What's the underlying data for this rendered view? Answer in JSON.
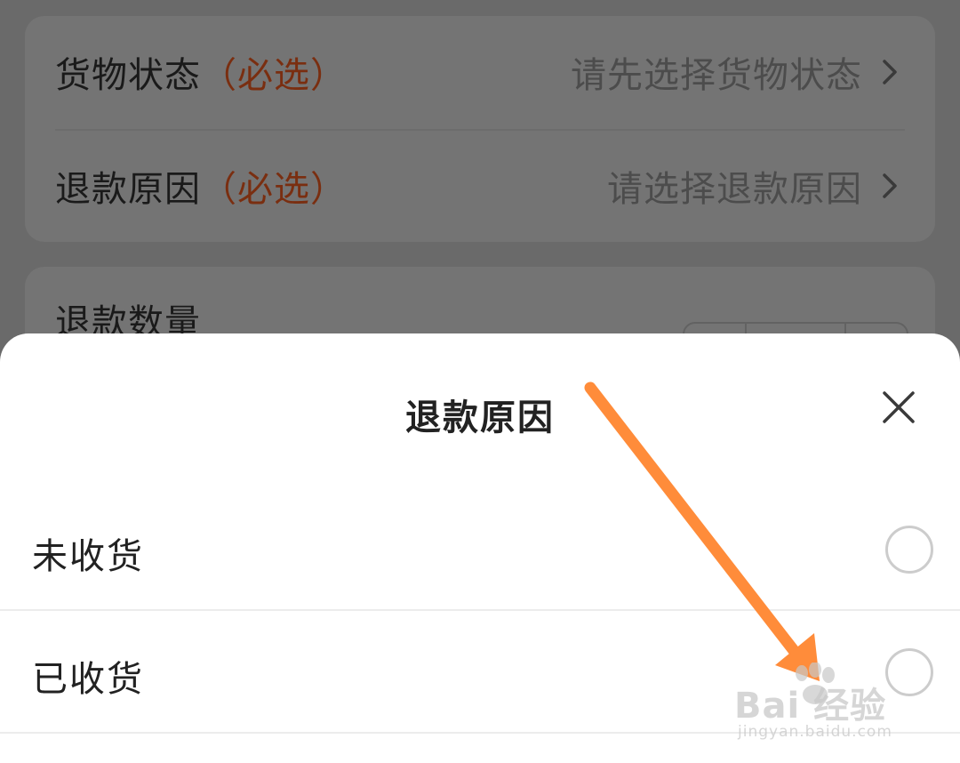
{
  "background_page": {
    "rows": [
      {
        "label": "货物状态",
        "required": "（必选）",
        "value": "请先选择货物状态"
      },
      {
        "label": "退款原因",
        "required": "（必选）",
        "value": "请选择退款原因"
      }
    ],
    "quantity_label": "退款数量"
  },
  "sheet": {
    "title": "退款原因",
    "options": [
      {
        "label": "未收货",
        "selected": false
      },
      {
        "label": "已收货",
        "selected": false
      }
    ]
  },
  "watermark": {
    "brand": "Bai 经验",
    "url": "jingyan.baidu.com"
  },
  "colors": {
    "overlay": "#616161",
    "required": "#7a2e10",
    "arrow": "#ff8c3a",
    "sheet_bg": "#ffffff"
  },
  "icons": [
    "chevron-right-icon",
    "close-icon",
    "radio-icon",
    "arrow-annotation-icon",
    "baidu-paw-icon"
  ]
}
